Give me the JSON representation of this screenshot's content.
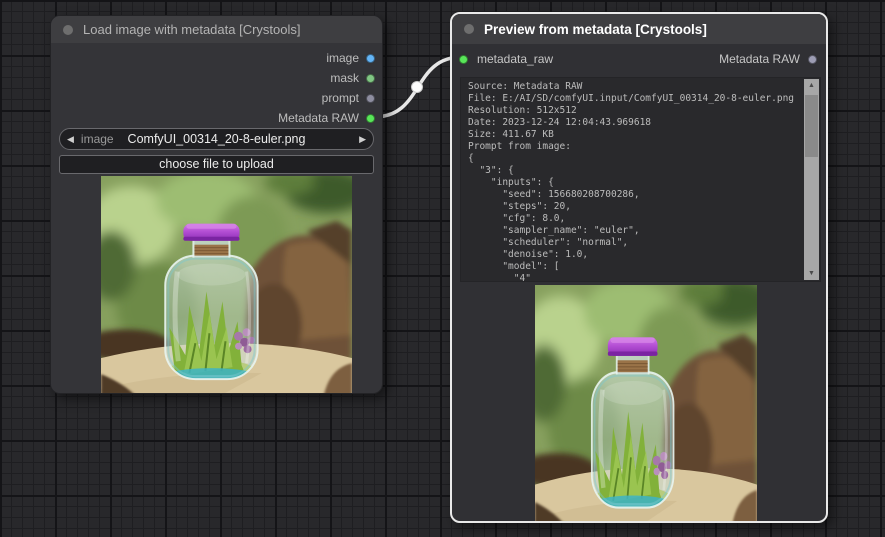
{
  "nodes": {
    "load_image": {
      "title": "Load image with metadata [Crystools]",
      "outputs": [
        {
          "label": "image",
          "color": "#64b5f6"
        },
        {
          "label": "mask",
          "color": "#81c784"
        },
        {
          "label": "prompt",
          "color": "#8e8ea0"
        },
        {
          "label": "Metadata RAW",
          "color": "#59e659"
        }
      ],
      "image_widget": {
        "label": "image",
        "value": "ComfyUI_00314_20-8-euler.png",
        "prev_icon": "◀",
        "next_icon": "▶"
      },
      "upload_button_label": "choose file to upload"
    },
    "preview": {
      "title": "Preview from metadata [Crystools]",
      "input": {
        "label": "metadata_raw",
        "color": "#59e659"
      },
      "output": {
        "label": "Metadata RAW",
        "color": "#9d9db4"
      },
      "metadata_lines": [
        "Source: Metadata RAW",
        "File: E:/AI/SD/comfyUI.input/ComfyUI_00314_20-8-euler.png",
        "Resolution: 512x512",
        "Date: 2023-12-24 12:04:43.969618",
        "Size: 411.67 KB",
        "Prompt from image:",
        "{",
        "  \"3\": {",
        "    \"inputs\": {",
        "      \"seed\": 156680208700286,",
        "      \"steps\": 20,",
        "      \"cfg\": 8.0,",
        "      \"sampler_name\": \"euler\",",
        "      \"scheduler\": \"normal\",",
        "      \"denoise\": 1.0,",
        "      \"model\": [",
        "        \"4\""
      ],
      "scrollbar": {
        "up_icon": "▲",
        "down_icon": "▼"
      }
    }
  },
  "wire": {
    "color": "#e8e8e8"
  }
}
